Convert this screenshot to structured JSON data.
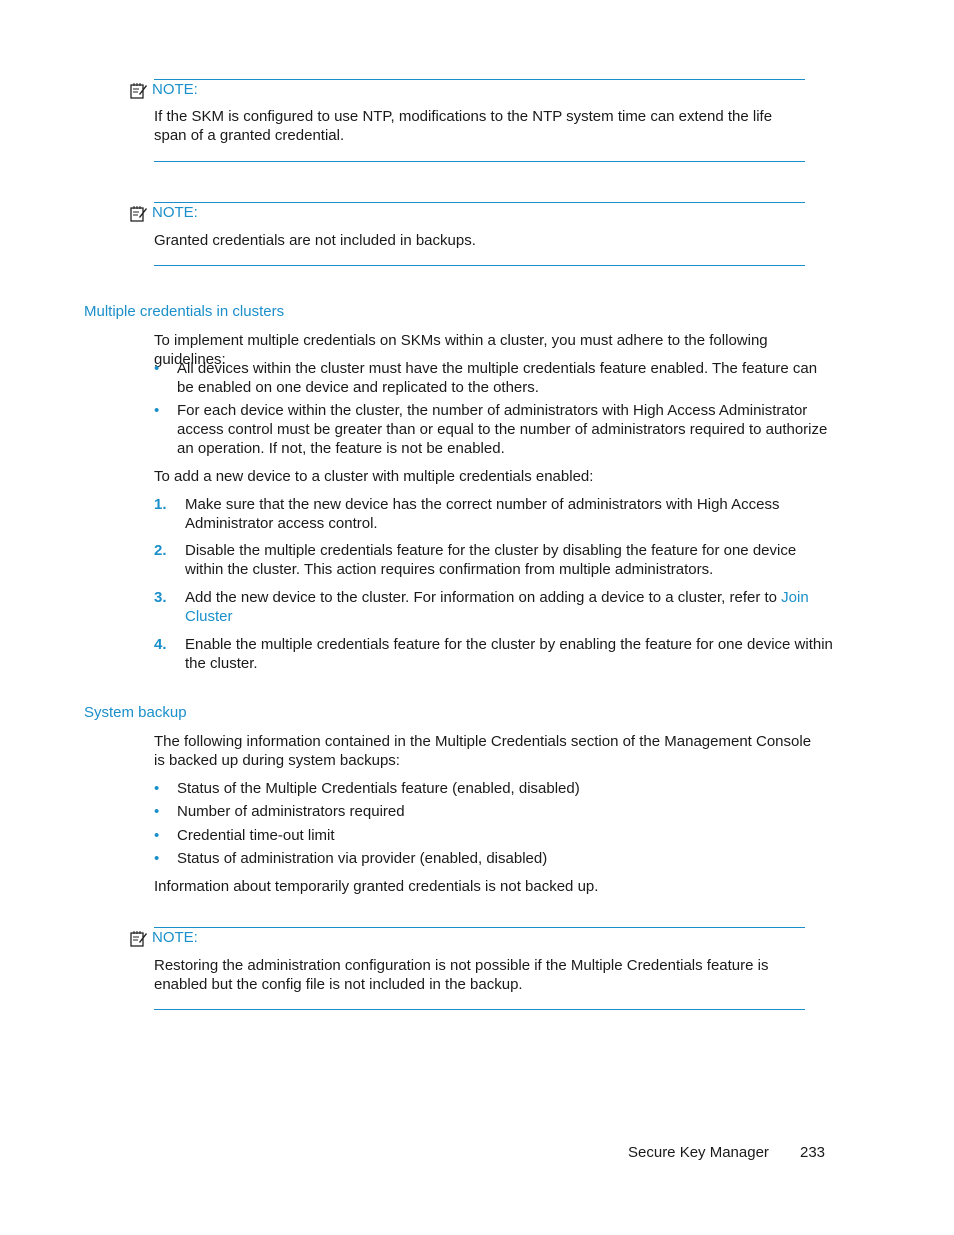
{
  "notes": [
    {
      "label": "NOTE:",
      "icon": "note-pencil-icon",
      "text": "If the SKM is configured to use NTP, modifications to the NTP system time can extend the life span of a granted credential."
    },
    {
      "label": "NOTE:",
      "icon": "note-pencil-icon",
      "text": "Granted credentials are not included in backups."
    },
    {
      "label": "NOTE:",
      "icon": "note-pencil-icon",
      "text": "Restoring the administration configuration is not possible if the Multiple Credentials feature is enabled but the config file is not included in the backup."
    }
  ],
  "section_clusters": {
    "heading": "Multiple credentials in clusters",
    "intro": "To implement multiple credentials on SKMs within a cluster, you must adhere to the following guidelines:",
    "bullets": [
      "All devices within the cluster must have the multiple credentials feature enabled. The feature can be enabled on one device and replicated to the others.",
      "For each device within the cluster, the number of administrators with High Access Administrator access control must be greater than or equal to the number of administrators required to authorize an operation. If not, the feature is not be enabled."
    ],
    "steps_intro": "To add a new device to a cluster with multiple credentials enabled:",
    "steps": [
      {
        "num": "1.",
        "text": "Make sure that the new device has the correct number of administrators with High Access Administrator access control."
      },
      {
        "num": "2.",
        "text": "Disable the multiple credentials feature for the cluster by disabling the feature for one device within the cluster. This action requires confirmation from multiple administrators."
      },
      {
        "num": "3.",
        "text": "Add the new device to the cluster. For information on adding a device to a cluster, refer to ",
        "link": "Join Cluster"
      },
      {
        "num": "4.",
        "text": "Enable the multiple credentials feature for the cluster by enabling the feature for one device within the cluster."
      }
    ]
  },
  "section_backup": {
    "heading": "System backup",
    "intro": "The following information contained in the Multiple Credentials section of the Management Console is backed up during system backups:",
    "bullets": [
      "Status of the Multiple Credentials feature (enabled, disabled)",
      "Number of administrators required",
      "Credential time-out limit",
      "Status of administration via provider (enabled, disabled)"
    ],
    "outro": "Information about temporarily granted credentials is not backed up."
  },
  "footer": {
    "title": "Secure Key Manager",
    "page_number": "233"
  }
}
